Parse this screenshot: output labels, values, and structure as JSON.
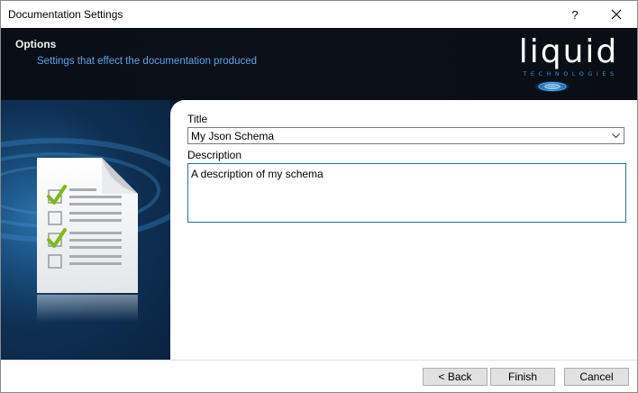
{
  "window": {
    "title": "Documentation Settings",
    "help_label": "?",
    "close_icon": "close-icon"
  },
  "header": {
    "heading": "Options",
    "subheading": "Settings that effect the documentation produced",
    "logo_text": "liquid",
    "logo_subtext": "TECHNOLOGIES"
  },
  "form": {
    "title_label": "Title",
    "title_value": "My Json Schema",
    "description_label": "Description",
    "description_value": "A description of my schema"
  },
  "footer": {
    "back_label": "< Back",
    "finish_label": "Finish",
    "cancel_label": "Cancel"
  },
  "colors": {
    "banner_bg": "#0b1018",
    "subheading": "#5aa4e6",
    "focus_border": "#2a6ea0",
    "check": "#7fb81a"
  }
}
